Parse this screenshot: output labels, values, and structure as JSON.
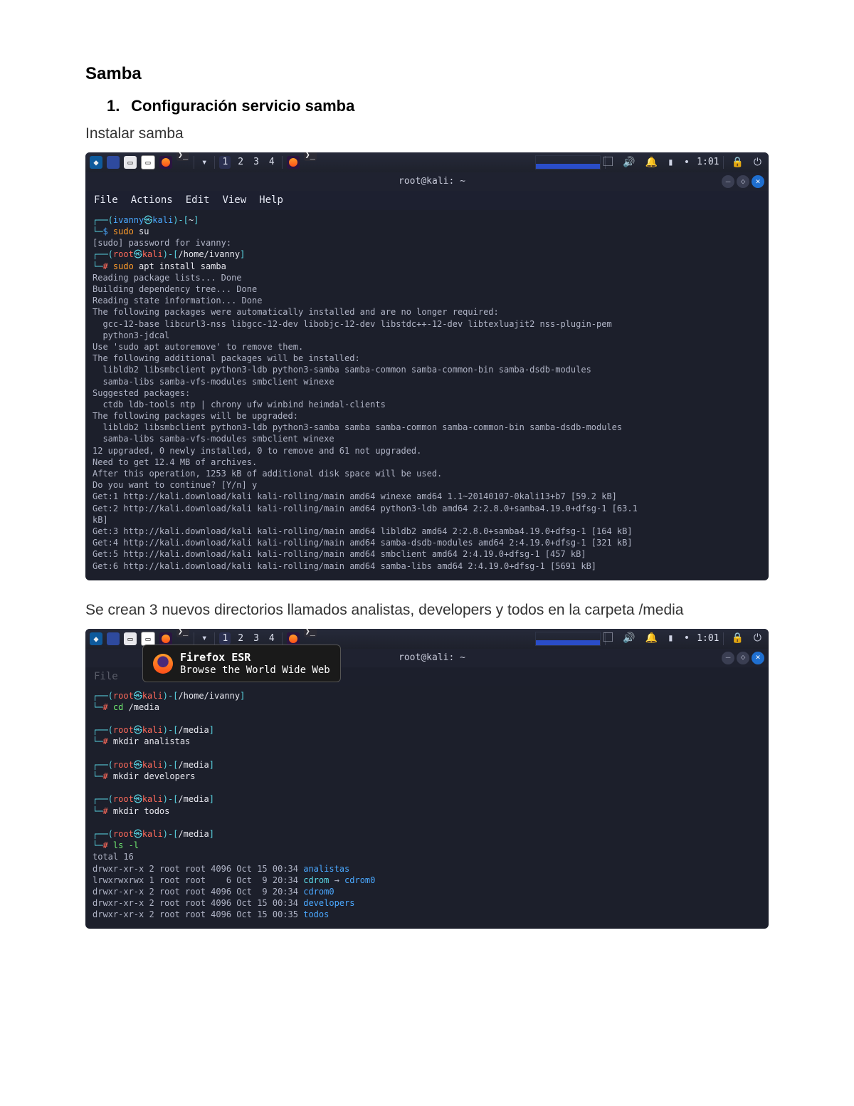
{
  "doc": {
    "title": "Samba",
    "section_num": "1.",
    "section_title": "Configuración servicio samba",
    "p1": "Instalar samba",
    "p2": "Se crean 3 nuevos directorios llamados analistas, developers y todos en la carpeta /media"
  },
  "bar": {
    "ws": [
      "1",
      "2",
      "3",
      "4"
    ],
    "time": "1:01"
  },
  "window_title": "root@kali: ~",
  "menu": {
    "file": "File",
    "actions": "Actions",
    "edit": "Edit",
    "view": "View",
    "help": "Help"
  },
  "tooltip": {
    "title": "Firefox ESR",
    "sub": "Browse the World Wide Web"
  },
  "term1": {
    "l1_user": "ivanny",
    "l1_host": "kali",
    "l1_path": "~",
    "l1_cmd_pre": "sudo",
    "l1_cmd": " su",
    "l2": "[sudo] password for ivanny:",
    "l3_user": "root",
    "l3_host": "kali",
    "l3_path": "/home/ivanny",
    "l3_cmd_pre": "sudo",
    "l3_cmd": " apt install samba",
    "l4": "Reading package lists... Done",
    "l5": "Building dependency tree... Done",
    "l6": "Reading state information... Done",
    "l7": "The following packages were automatically installed and are no longer required:",
    "l8": "  gcc-12-base libcurl3-nss libgcc-12-dev libobjc-12-dev libstdc++-12-dev libtexluajit2 nss-plugin-pem",
    "l9": "  python3-jdcal",
    "l10": "Use 'sudo apt autoremove' to remove them.",
    "l11": "The following additional packages will be installed:",
    "l12": "  libldb2 libsmbclient python3-ldb python3-samba samba-common samba-common-bin samba-dsdb-modules",
    "l13": "  samba-libs samba-vfs-modules smbclient winexe",
    "l14": "Suggested packages:",
    "l15": "  ctdb ldb-tools ntp | chrony ufw winbind heimdal-clients",
    "l16": "The following packages will be upgraded:",
    "l17": "  libldb2 libsmbclient python3-ldb python3-samba samba samba-common samba-common-bin samba-dsdb-modules",
    "l18": "  samba-libs samba-vfs-modules smbclient winexe",
    "l19": "12 upgraded, 0 newly installed, 0 to remove and 61 not upgraded.",
    "l20": "Need to get 12.4 MB of archives.",
    "l21": "After this operation, 1253 kB of additional disk space will be used.",
    "l22": "Do you want to continue? [Y/n] y",
    "l23": "Get:1 http://kali.download/kali kali-rolling/main amd64 winexe amd64 1.1~20140107-0kali13+b7 [59.2 kB]",
    "l24": "Get:2 http://kali.download/kali kali-rolling/main amd64 python3-ldb amd64 2:2.8.0+samba4.19.0+dfsg-1 [63.1",
    "l25": "kB]",
    "l26": "Get:3 http://kali.download/kali kali-rolling/main amd64 libldb2 amd64 2:2.8.0+samba4.19.0+dfsg-1 [164 kB]",
    "l27": "Get:4 http://kali.download/kali kali-rolling/main amd64 samba-dsdb-modules amd64 2:4.19.0+dfsg-1 [321 kB]",
    "l28": "Get:5 http://kali.download/kali kali-rolling/main amd64 smbclient amd64 2:4.19.0+dfsg-1 [457 kB]",
    "l29": "Get:6 http://kali.download/kali kali-rolling/main amd64 samba-libs amd64 2:4.19.0+dfsg-1 [5691 kB]"
  },
  "term2": {
    "p1_user": "root",
    "p1_host": "kali",
    "p1_path": "/home/ivanny",
    "p1_cmd": "cd /media",
    "p2_path": "/media",
    "p2_cmd": "mkdir analistas",
    "p3_cmd": "mkdir developers",
    "p4_cmd": "mkdir todos",
    "p5_cmd": "ls -l",
    "out_total": "total 16",
    "out1_perm": "drwxr-xr-x 2 root root 4096 Oct 15 00:34 ",
    "out1_name": "analistas",
    "out2_perm": "lrwxrwxrwx 1 root root    6 Oct  9 20:34 ",
    "out2_name": "cdrom",
    "out2_arrow": " → ",
    "out2_target": "cdrom0",
    "out3_perm": "drwxr-xr-x 2 root root 4096 Oct  9 20:34 ",
    "out3_name": "cdrom0",
    "out4_perm": "drwxr-xr-x 2 root root 4096 Oct 15 00:34 ",
    "out4_name": "developers",
    "out5_perm": "drwxr-xr-x 2 root root 4096 Oct 15 00:35 ",
    "out5_name": "todos"
  }
}
